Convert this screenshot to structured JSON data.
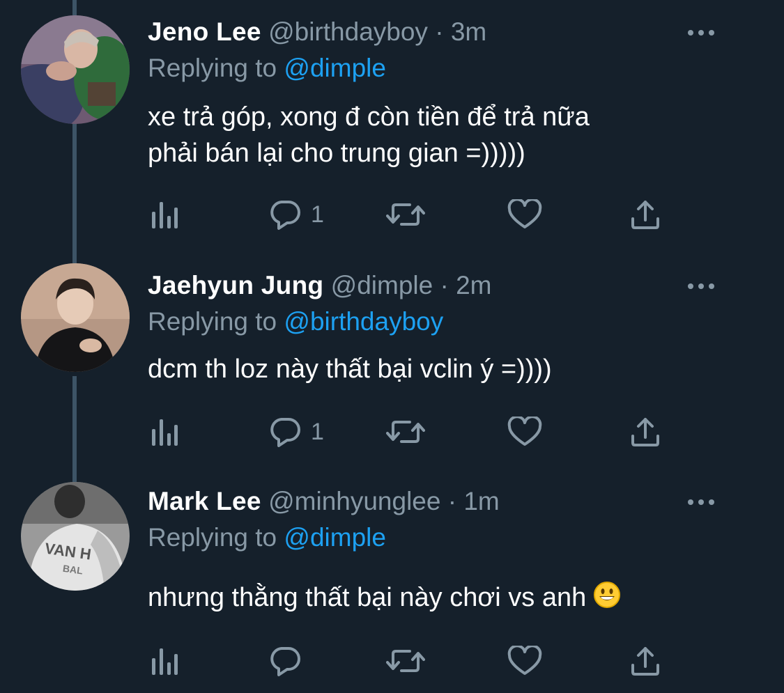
{
  "tweets": [
    {
      "name": "Jeno Lee",
      "handle": "@birthdayboy",
      "separator": "·",
      "time": "3m",
      "replying_prefix": "Replying to",
      "replying_to": "@dimple",
      "text_lines": [
        "xe trả góp, xong đ còn tiền để trả nữa",
        "phải bán lại cho trung gian =)))))"
      ],
      "reply_count": "1",
      "avatar_icon": "person-photo"
    },
    {
      "name": "Jaehyun Jung",
      "handle": "@dimple",
      "separator": "·",
      "time": "2m",
      "replying_prefix": "Replying to",
      "replying_to": "@birthdayboy",
      "text_lines": [
        "dcm th loz này thất bại vclin ý =))))"
      ],
      "reply_count": "1",
      "avatar_icon": "person-photo"
    },
    {
      "name": "Mark Lee",
      "handle": "@minhyunglee",
      "separator": "·",
      "time": "1m",
      "replying_prefix": "Replying to",
      "replying_to": "@dimple",
      "text_lines": [
        "nhưng thằng thất bại này chơi vs anh"
      ],
      "text_emoji": "grinning-face-emoji",
      "reply_count": "",
      "avatar_icon": "person-photo-bw",
      "avatar_lettering": [
        "VAN H",
        "BAL"
      ]
    }
  ],
  "icons": {
    "analytics": "bar-chart-icon",
    "reply": "speech-bubble-icon",
    "retweet": "retweet-arrows-icon",
    "like": "heart-icon",
    "share": "share-upload-icon",
    "more": "more-dots-icon"
  },
  "colors": {
    "background": "#15202B",
    "primary_text": "#FFFFFF",
    "secondary_text": "#8899A6",
    "mention": "#1DA1F2",
    "thread_line": "#3D5466"
  }
}
